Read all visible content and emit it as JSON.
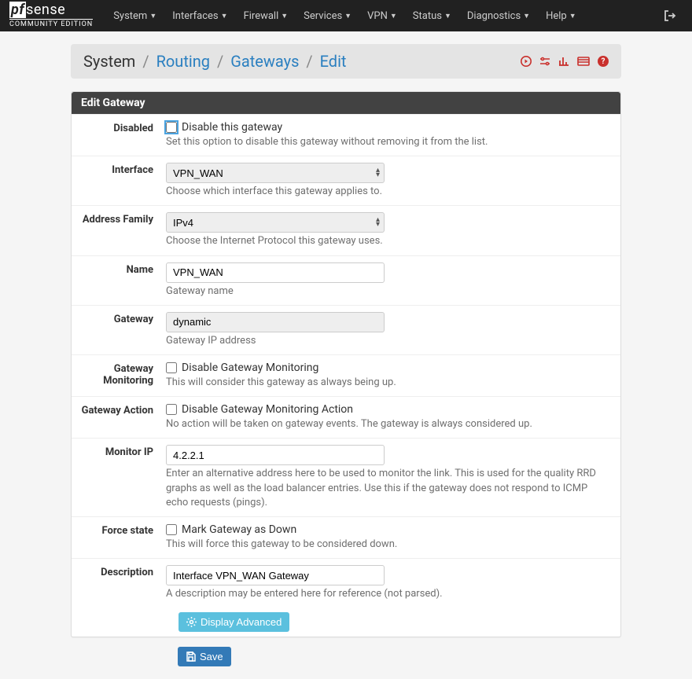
{
  "nav": {
    "items": [
      "System",
      "Interfaces",
      "Firewall",
      "Services",
      "VPN",
      "Status",
      "Diagnostics",
      "Help"
    ],
    "logo_sub": "COMMUNITY EDITION"
  },
  "breadcrumb": {
    "root": "System",
    "l1": "Routing",
    "l2": "Gateways",
    "l3": "Edit"
  },
  "panel_title": "Edit Gateway",
  "fields": {
    "disabled": {
      "label": "Disabled",
      "check_label": "Disable this gateway",
      "help": "Set this option to disable this gateway without removing it from the list."
    },
    "interface": {
      "label": "Interface",
      "value": "VPN_WAN",
      "help": "Choose which interface this gateway applies to."
    },
    "addr_family": {
      "label": "Address Family",
      "value": "IPv4",
      "help": "Choose the Internet Protocol this gateway uses."
    },
    "name": {
      "label": "Name",
      "value": "VPN_WAN",
      "help": "Gateway name"
    },
    "gateway": {
      "label": "Gateway",
      "value": "dynamic",
      "help": "Gateway IP address"
    },
    "monitoring": {
      "label": "Gateway Monitoring",
      "check_label": "Disable Gateway Monitoring",
      "help": "This will consider this gateway as always being up."
    },
    "action": {
      "label": "Gateway Action",
      "check_label": "Disable Gateway Monitoring Action",
      "help": "No action will be taken on gateway events. The gateway is always considered up."
    },
    "monitor_ip": {
      "label": "Monitor IP",
      "value": "4.2.2.1",
      "help": "Enter an alternative address here to be used to monitor the link. This is used for the quality RRD graphs as well as the load balancer entries. Use this if the gateway does not respond to ICMP echo requests (pings)."
    },
    "force_state": {
      "label": "Force state",
      "check_label": "Mark Gateway as Down",
      "help": "This will force this gateway to be considered down."
    },
    "description": {
      "label": "Description",
      "value": "Interface VPN_WAN Gateway",
      "help": "A description may be entered here for reference (not parsed)."
    }
  },
  "buttons": {
    "advanced": "Display Advanced",
    "save": "Save"
  }
}
